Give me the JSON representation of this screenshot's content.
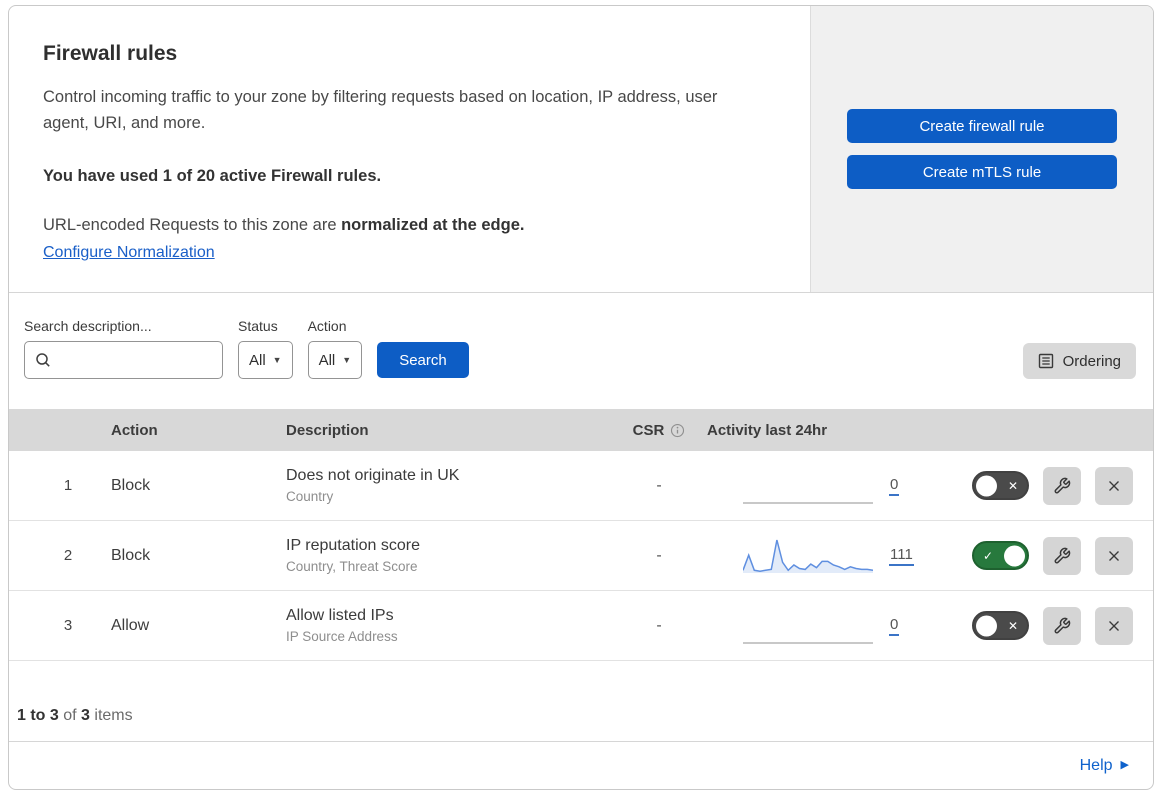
{
  "header": {
    "title": "Firewall rules",
    "description": "Control incoming traffic to your zone by filtering requests based on location, IP address, user agent, URI, and more.",
    "usage": "You have used 1 of 20 active Firewall rules.",
    "normalization_text": "URL-encoded Requests to this zone are ",
    "normalization_bold": "normalized at the edge.",
    "normalization_link": "Configure Normalization",
    "create_firewall_button": "Create firewall rule",
    "create_mtls_button": "Create mTLS rule"
  },
  "filters": {
    "search_label": "Search description...",
    "status_label": "Status",
    "status_value": "All",
    "action_label": "Action",
    "action_value": "All",
    "search_button": "Search",
    "ordering_button": "Ordering"
  },
  "table": {
    "columns": {
      "action": "Action",
      "description": "Description",
      "csr": "CSR",
      "activity": "Activity last 24hr"
    },
    "rows": [
      {
        "num": "1",
        "action": "Block",
        "title": "Does not originate in UK",
        "subtitle": "Country",
        "csr": "-",
        "count": "0",
        "enabled": false,
        "series": []
      },
      {
        "num": "2",
        "action": "Block",
        "title": "IP reputation score",
        "subtitle": "Country, Threat Score",
        "csr": "-",
        "count": "111",
        "enabled": true,
        "series": [
          3,
          20,
          3,
          2,
          3,
          4,
          37,
          12,
          3,
          9,
          5,
          4,
          10,
          6,
          13,
          13,
          9,
          7,
          4,
          7,
          5,
          4,
          4,
          3
        ]
      },
      {
        "num": "3",
        "action": "Allow",
        "title": "Allow listed IPs",
        "subtitle": "IP Source Address",
        "csr": "-",
        "count": "0",
        "enabled": false,
        "series": []
      }
    ]
  },
  "footer": {
    "range": "1 to 3",
    "of": "of",
    "total": "3",
    "items": "items",
    "help": "Help"
  },
  "icons": {
    "check": "✓",
    "cross": "✕",
    "caret": "▼",
    "help_arrow": "▶"
  },
  "colors": {
    "accent_blue": "#0d5dc5",
    "toggle_on_green": "#27793d",
    "toggle_off_gray": "#4a4a4a",
    "sparkline_blue": "#5f8fe0",
    "header_gray": "#d8d8d8"
  }
}
